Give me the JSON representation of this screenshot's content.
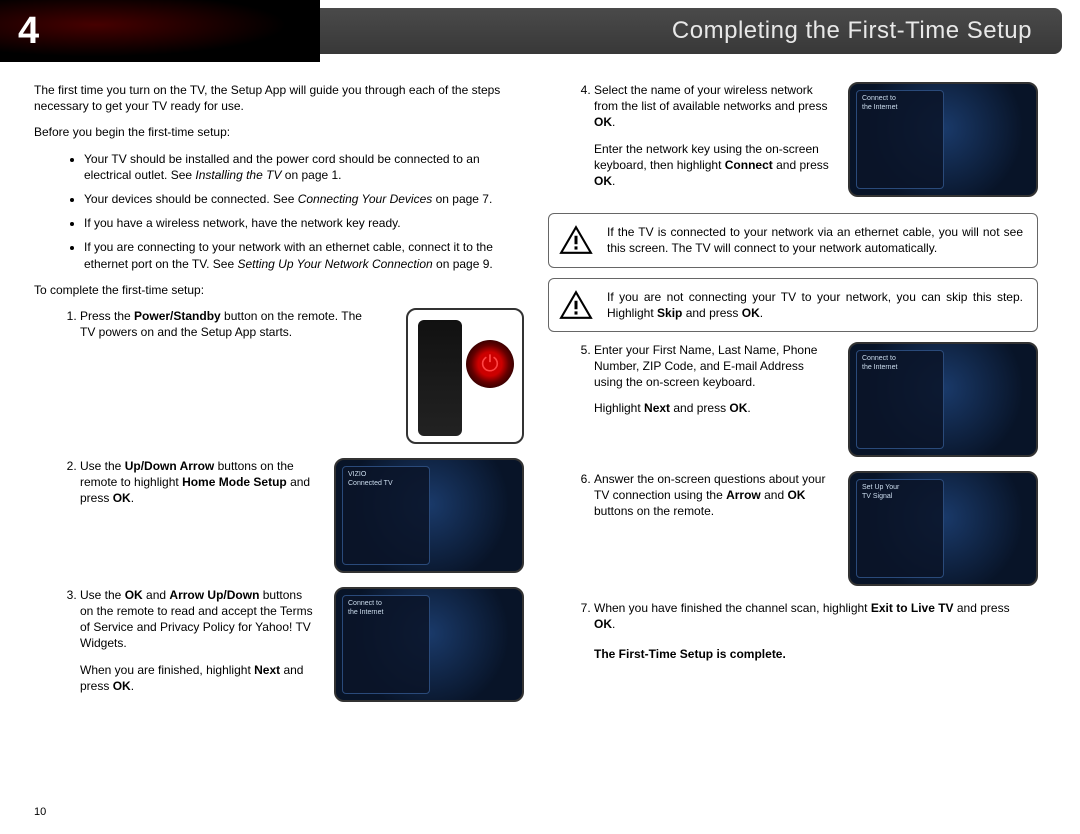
{
  "chapter": "4",
  "title": "Completing the First-Time Setup",
  "intro": "The first time you turn on the TV, the Setup App will guide you through each of the steps necessary to get your TV ready for use.",
  "before_heading": "Before you begin the first-time setup:",
  "bullets": {
    "b1a": "Your TV should be installed and the power cord should be connected to an electrical outlet. See ",
    "b1_em": "Installing the TV",
    "b1b": " on page 1.",
    "b2a": "Your devices should be connected. See ",
    "b2_em": "Connecting Your Devices",
    "b2b": " on page 7.",
    "b3": "If you have a wireless network, have the network key ready.",
    "b4a": "If you are connecting to your network with an ethernet cable, connect it to the ethernet port on the TV. See ",
    "b4_em": "Setting Up Your Network Connection",
    "b4b": " on page 9."
  },
  "to_complete": "To complete the first-time setup:",
  "steps_left": {
    "s1a": "Press the ",
    "s1_b1": "Power/Standby",
    "s1b": " button on the remote. The TV powers on and the Setup App starts.",
    "s2a": "Use the ",
    "s2_b1": "Up/Down Arrow",
    "s2b": " buttons on the remote to highlight ",
    "s2_b2": "Home Mode Setup",
    "s2c": " and press ",
    "s2_b3": "OK",
    "s2d": ".",
    "s3a": "Use the ",
    "s3_b1": "OK",
    "s3b": " and ",
    "s3_b2": "Arrow Up/Down",
    "s3c": " buttons on the remote to read and accept the Terms of Service and Privacy Policy for Yahoo! TV Widgets.",
    "s3_p2a": "When you are finished, highlight ",
    "s3_p2_b1": "Next",
    "s3_p2b": " and press ",
    "s3_p2_b2": "OK",
    "s3_p2c": "."
  },
  "steps_right": {
    "s4a": "Select the name of your wireless network from the list of available networks and press ",
    "s4_b1": "OK",
    "s4b": ".",
    "s4_p2a": "Enter the network key using the on-screen keyboard, then highlight ",
    "s4_p2_b1": "Connect",
    "s4_p2b": " and press ",
    "s4_p2_b2": "OK",
    "s4_p2c": ".",
    "s5a": "Enter your First Name, Last Name, Phone Number, ZIP Code, and E-mail Address using the on-screen keyboard.",
    "s5_p2a": "Highlight ",
    "s5_p2_b1": "Next",
    "s5_p2b": " and press ",
    "s5_p2_b2": "OK",
    "s5_p2c": ".",
    "s6a": "Answer the on-screen questions about your TV connection using the ",
    "s6_b1": "Arrow",
    "s6b": " and ",
    "s6_b2": "OK",
    "s6c": " buttons on the remote.",
    "s7a": "When you have finished the channel scan, highlight ",
    "s7_b1": "Exit to Live TV",
    "s7b": " and press ",
    "s7_b2": "OK",
    "s7c": "."
  },
  "info1a": "If the TV is connected to your network via an ethernet cable, you will not see this screen. The TV will connect to your network automatically.",
  "info2a": "If you are not connecting your TV to your network, you can skip this step. Highlight ",
  "info2_b1": "Skip",
  "info2b": " and press ",
  "info2_b2": "OK",
  "info2c": ".",
  "complete": "The First-Time Setup is complete.",
  "pagenum": "10"
}
